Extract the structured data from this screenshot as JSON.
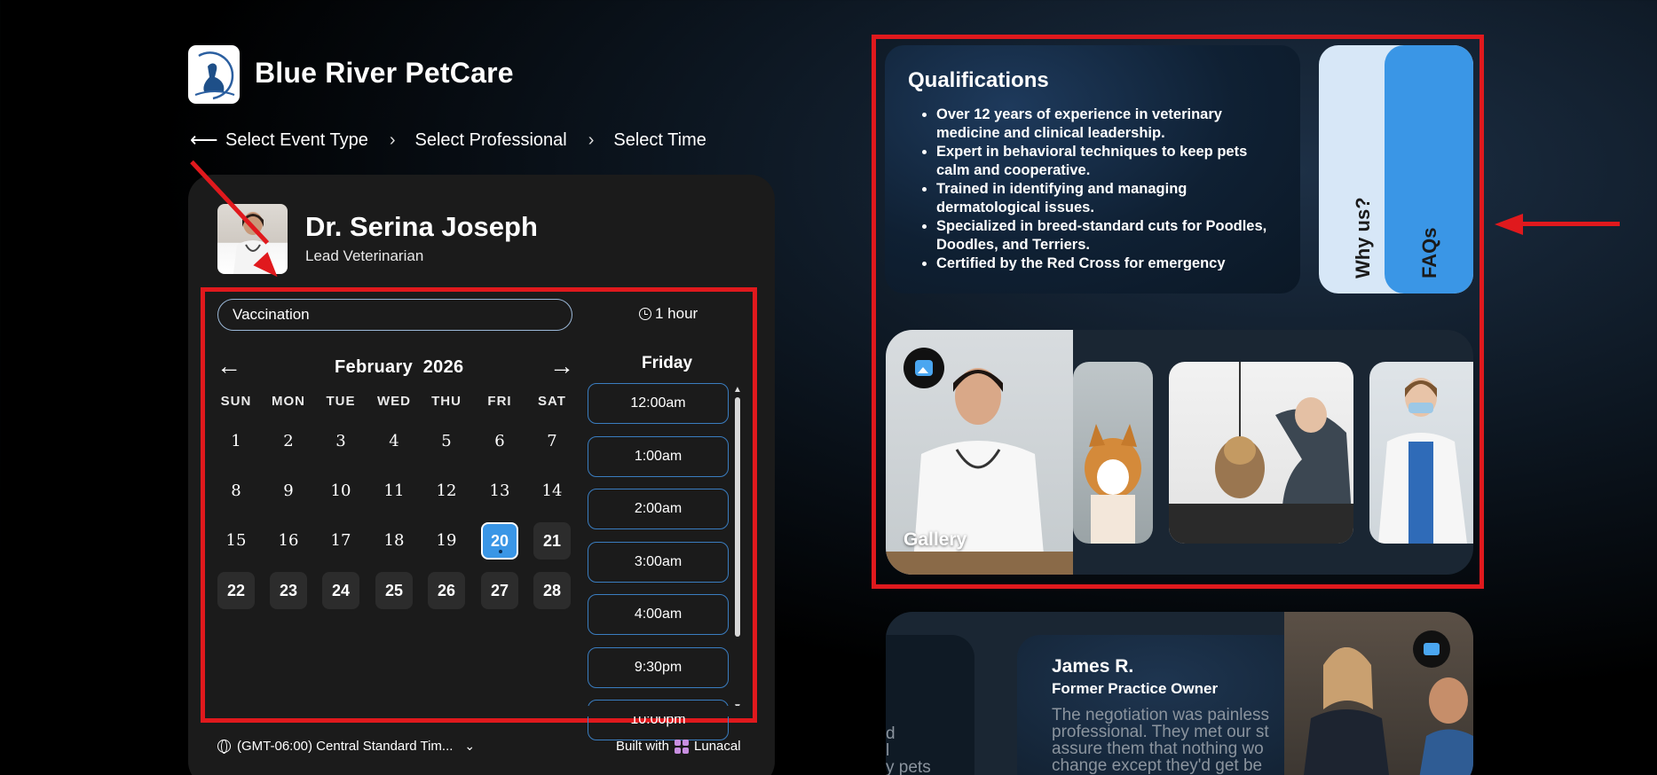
{
  "brand": {
    "name": "Blue River PetCare"
  },
  "breadcrumbs": {
    "back_icon": "arrow-left-icon",
    "items": [
      "Select Event Type",
      "Select Professional",
      "Select Time"
    ]
  },
  "professional": {
    "name": "Dr. Serina Joseph",
    "role": "Lead Veterinarian"
  },
  "event": {
    "type": "Vaccination",
    "duration": "1 hour"
  },
  "calendar": {
    "month": "February",
    "year": "2026",
    "prev": "←",
    "next": "→",
    "weekdays": [
      "SUN",
      "MON",
      "TUE",
      "WED",
      "THU",
      "FRI",
      "SAT"
    ],
    "weeks": [
      [
        "1",
        "2",
        "3",
        "4",
        "5",
        "6",
        "7"
      ],
      [
        "8",
        "9",
        "10",
        "11",
        "12",
        "13",
        "14"
      ],
      [
        "15",
        "16",
        "17",
        "18",
        "19",
        "20",
        "21"
      ],
      [
        "22",
        "23",
        "24",
        "25",
        "26",
        "27",
        "28"
      ]
    ],
    "selected": "20",
    "available": [
      "21",
      "22",
      "23",
      "24",
      "25",
      "26",
      "27",
      "28"
    ]
  },
  "times": {
    "day": "Friday",
    "slots": [
      "12:00am",
      "1:00am",
      "2:00am",
      "3:00am",
      "4:00am",
      "9:30pm",
      "10:00pm"
    ]
  },
  "footer": {
    "timezone": "(GMT-06:00) Central Standard Tim...",
    "built_with": "Built with",
    "builder": "Lunacal"
  },
  "qualifications": {
    "title": "Qualifications",
    "items": [
      "Over 12 years of experience in veterinary medicine and clinical leadership.",
      "Expert in behavioral techniques to keep pets calm and cooperative.",
      "Trained in identifying and managing dermatological issues.",
      "Specialized in breed-standard cuts for Poodles, Doodles, and Terriers.",
      "Certified by the Red Cross for emergency"
    ]
  },
  "tabs": {
    "why": "Why us?",
    "faq": "FAQs"
  },
  "gallery": {
    "label": "Gallery"
  },
  "testimonial": {
    "name": "James R.",
    "role": "Former Practice Owner",
    "quote_lines": [
      "The negotiation was painless",
      "professional. They met our st",
      "assure them that nothing wo",
      "change except they'd get be"
    ],
    "left_fragments": [
      "d",
      "l",
      "y pets"
    ]
  },
  "colors": {
    "accent": "#3a96e6",
    "highlight": "#e0191d",
    "card": "#1b1b1b"
  }
}
